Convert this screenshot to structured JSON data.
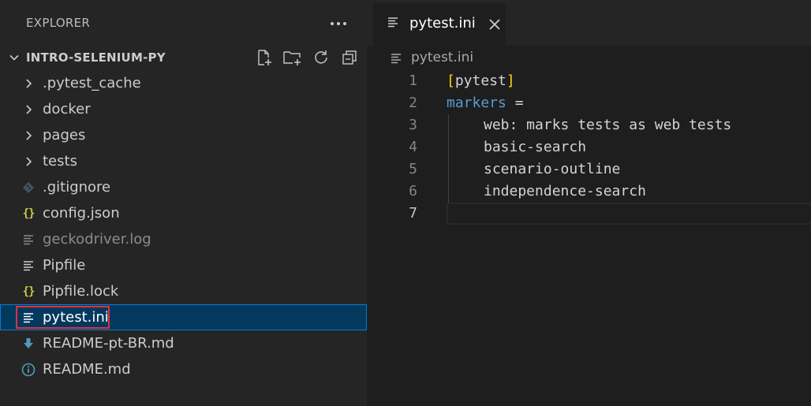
{
  "explorer": {
    "title": "EXPLORER",
    "project_name": "INTRO-SELENIUM-PY",
    "actions": [
      "new-file-icon",
      "new-folder-icon",
      "refresh-icon",
      "collapse-all-icon"
    ],
    "items": [
      {
        "label": ".pytest_cache",
        "type": "folder",
        "icon": "chevron-right-icon"
      },
      {
        "label": "docker",
        "type": "folder",
        "icon": "chevron-right-icon"
      },
      {
        "label": "pages",
        "type": "folder",
        "icon": "chevron-right-icon"
      },
      {
        "label": "tests",
        "type": "folder",
        "icon": "chevron-right-icon"
      },
      {
        "label": ".gitignore",
        "type": "file",
        "icon": "git-icon"
      },
      {
        "label": "config.json",
        "type": "file",
        "icon": "json-icon",
        "icon_text": "{}"
      },
      {
        "label": "geckodriver.log",
        "type": "file",
        "icon": "lines-icon",
        "muted": true
      },
      {
        "label": "Pipfile",
        "type": "file",
        "icon": "lines-icon"
      },
      {
        "label": "Pipfile.lock",
        "type": "file",
        "icon": "json-icon",
        "icon_text": "{}"
      },
      {
        "label": "pytest.ini",
        "type": "file",
        "icon": "lines-icon",
        "selected": true
      },
      {
        "label": "README-pt-BR.md",
        "type": "file",
        "icon": "download-arrow-icon"
      },
      {
        "label": "README.md",
        "type": "file",
        "icon": "info-icon"
      }
    ]
  },
  "editor": {
    "tab_label": "pytest.ini",
    "breadcrumb": "pytest.ini",
    "lines": [
      {
        "num": "1",
        "section_open": "[",
        "section_name": "pytest",
        "section_close": "]"
      },
      {
        "num": "2",
        "key": "markers",
        "rest": " ="
      },
      {
        "num": "3",
        "text": "web: marks tests as web tests"
      },
      {
        "num": "4",
        "text": "basic-search"
      },
      {
        "num": "5",
        "text": "scenario-outline"
      },
      {
        "num": "6",
        "text": "independence-search"
      },
      {
        "num": "7",
        "text": ""
      }
    ]
  },
  "colors": {
    "sidebar_bg": "#252526",
    "editor_bg": "#1e1e1e",
    "selection_bg": "#04395e",
    "selection_border": "#007fd4",
    "highlight_red": "#e0313e",
    "bracket_yellow": "#ffd700",
    "key_blue": "#569cd6",
    "json_icon_yellow": "#cbcb41",
    "download_icon_blue": "#519aba",
    "info_icon_blue": "#519aba",
    "git_icon_gray": "#41535b"
  }
}
